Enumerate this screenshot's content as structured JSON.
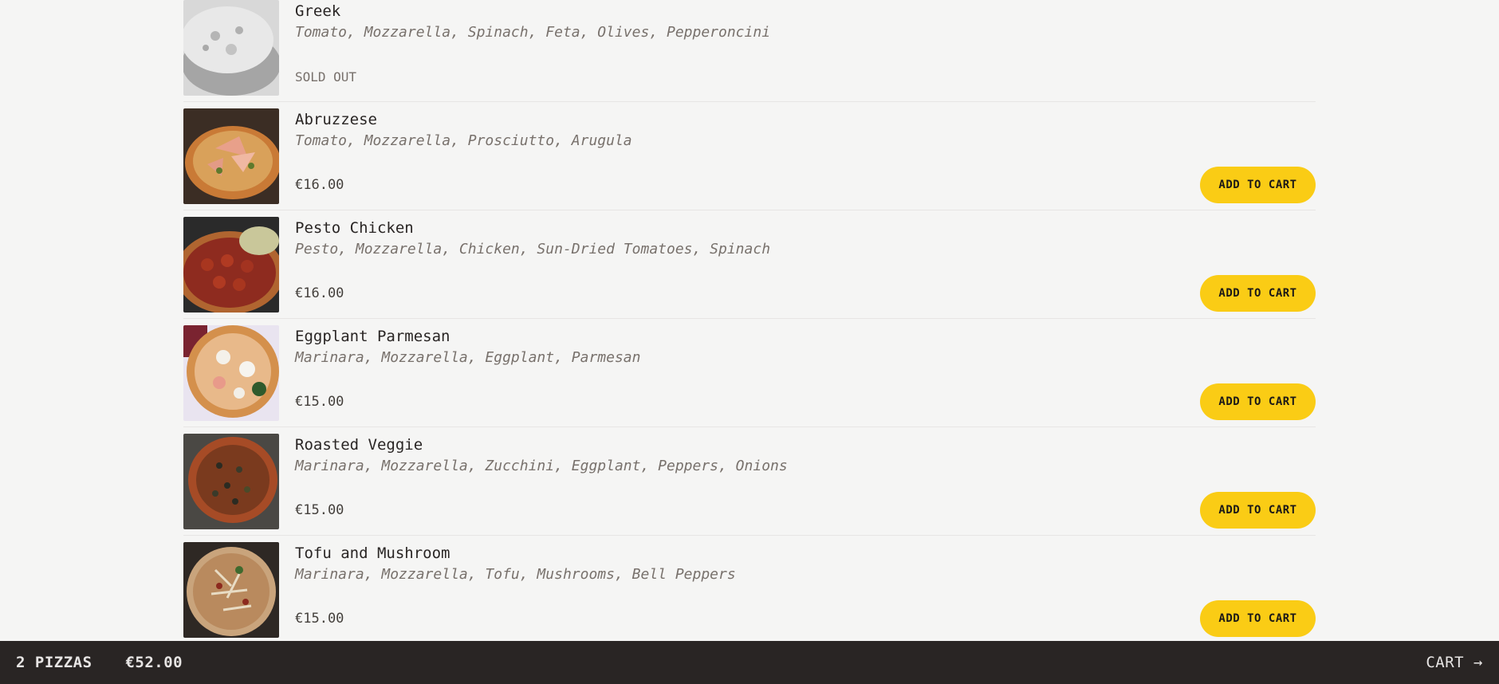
{
  "menu": {
    "items": [
      {
        "name": "Greek",
        "ingredients": "Tomato, Mozzarella, Spinach, Feta, Olives, Pepperoncini",
        "status": "SOLD OUT"
      },
      {
        "name": "Abruzzese",
        "ingredients": "Tomato, Mozzarella, Prosciutto, Arugula",
        "price": "€16.00",
        "button": "ADD TO CART"
      },
      {
        "name": "Pesto Chicken",
        "ingredients": "Pesto, Mozzarella, Chicken, Sun-Dried Tomatoes, Spinach",
        "price": "€16.00",
        "button": "ADD TO CART"
      },
      {
        "name": "Eggplant Parmesan",
        "ingredients": "Marinara, Mozzarella, Eggplant, Parmesan",
        "price": "€15.00",
        "button": "ADD TO CART"
      },
      {
        "name": "Roasted Veggie",
        "ingredients": "Marinara, Mozzarella, Zucchini, Eggplant, Peppers, Onions",
        "price": "€15.00",
        "button": "ADD TO CART"
      },
      {
        "name": "Tofu and Mushroom",
        "ingredients": "Marinara, Mozzarella, Tofu, Mushrooms, Bell Peppers",
        "price": "€15.00",
        "button": "ADD TO CART"
      }
    ]
  },
  "cart": {
    "count": "2 PIZZAS",
    "total": "€52.00",
    "link": "CART →"
  },
  "colors": {
    "accent": "#facc15",
    "background": "#f5f5f4",
    "bar": "#292524"
  }
}
